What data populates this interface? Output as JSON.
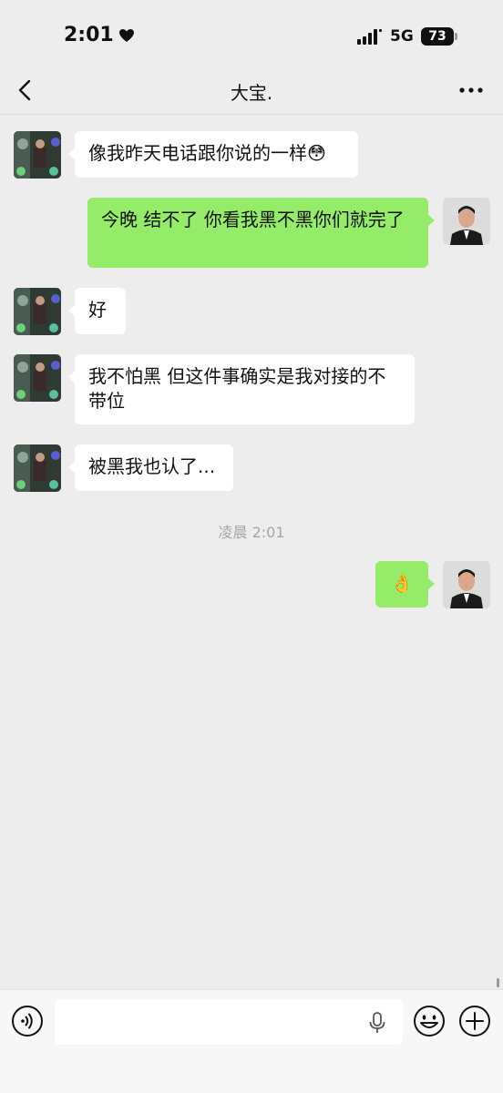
{
  "status_bar": {
    "time": "2:01",
    "network": "5G",
    "battery": "73"
  },
  "nav": {
    "title": "大宝."
  },
  "messages": [
    {
      "direction": "in",
      "text": "像我昨天电话跟你说的一样😳"
    },
    {
      "direction": "out",
      "text": "今晚  结不了   你看我黑不黑你们就完了"
    },
    {
      "direction": "in",
      "text": "好"
    },
    {
      "direction": "in",
      "text": "我不怕黑 但这件事确实是我对接的不带位"
    },
    {
      "direction": "in",
      "text": "被黑我也认了..."
    },
    {
      "direction": "out",
      "text": "👌"
    }
  ],
  "timestamp": "凌晨 2:01",
  "input": {
    "value": "",
    "placeholder": ""
  },
  "icons": {
    "back": "chevron-left-icon",
    "more": "more-dots-icon",
    "voice": "voice-icon",
    "mic": "microphone-icon",
    "emoji": "emoji-icon",
    "plus": "plus-icon"
  },
  "colors": {
    "background": "#ededed",
    "bubble_in": "#ffffff",
    "bubble_out": "#95ec69",
    "timestamp": "#a6a6a6"
  }
}
